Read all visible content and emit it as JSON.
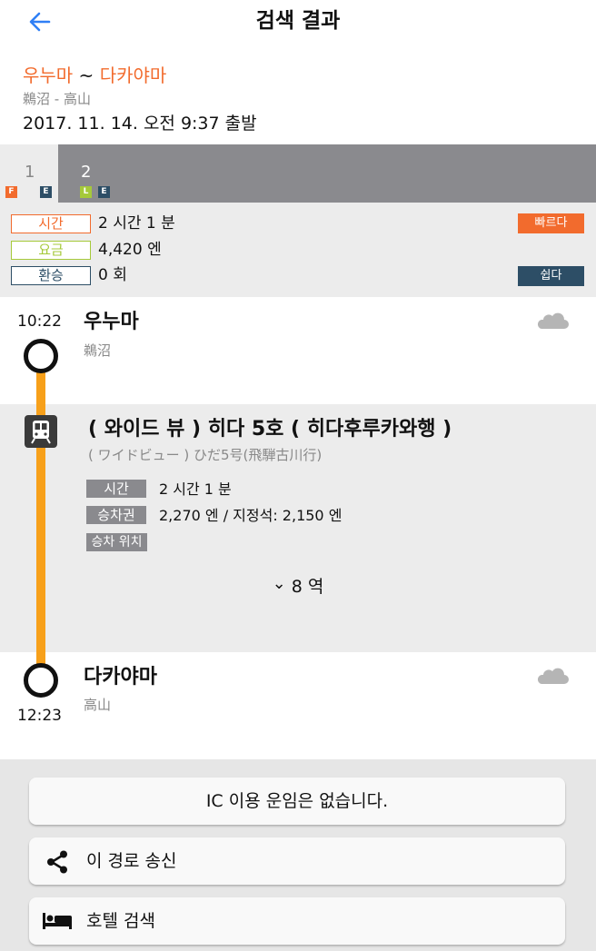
{
  "header": {
    "back_label": "←",
    "title": "검색 결과"
  },
  "route": {
    "from": "우누마",
    "separator": " ~ ",
    "to": "다카야마",
    "subtitle": "鵜沼 - 高山",
    "departure": "2017. 11. 14. 오전 9:37 출발"
  },
  "tabs": [
    {
      "number": "1",
      "badges": [
        {
          "text": "F",
          "color": "#f26b2d"
        },
        {
          "text": "E",
          "color": "#2d4e66"
        }
      ]
    },
    {
      "number": "2",
      "badges": [
        {
          "text": "L",
          "color": "#a5c93a"
        },
        {
          "text": "E",
          "color": "#2d4e66"
        }
      ]
    }
  ],
  "summary": {
    "time_label": "시간",
    "time_value": "2 시간 1 분",
    "fare_label": "요금",
    "fare_value": "4,420 엔",
    "transfer_label": "환승",
    "transfer_value": "0 회",
    "fast_badge": "빠르다",
    "easy_badge": "쉽다"
  },
  "colors": {
    "accent_orange": "#f26b2d",
    "fare_green": "#a5c93a",
    "navy": "#2d4e66",
    "line_orange": "#f7a01a",
    "link_blue": "#2f7ff5"
  },
  "departure_stop": {
    "time": "10:22",
    "name": "우누마",
    "name_jp": "鵜沼",
    "weather_icon": "cloud-icon"
  },
  "train": {
    "title": "( 와이드 뷰 ) 히다 5호 ( 히다후루카와행 )",
    "title_jp": "( ワイドビュー ) ひだ5号(飛騨古川行)",
    "time_label": "시간",
    "time_value": "2 시간 1 분",
    "ticket_label": "승차권",
    "ticket_value": "2,270 엔 / 지정석: 2,150 엔",
    "position_label": "승차 위치",
    "stops_chevron": "⌄",
    "stops_label": "8 역"
  },
  "arrival_stop": {
    "time": "12:23",
    "name": "다카야마",
    "name_jp": "高山",
    "weather_icon": "cloud-icon"
  },
  "buttons": {
    "ic_fare": "IC 이용 운임은 없습니다.",
    "share": "이 경로 송신",
    "hotel": "호텔 검색"
  }
}
